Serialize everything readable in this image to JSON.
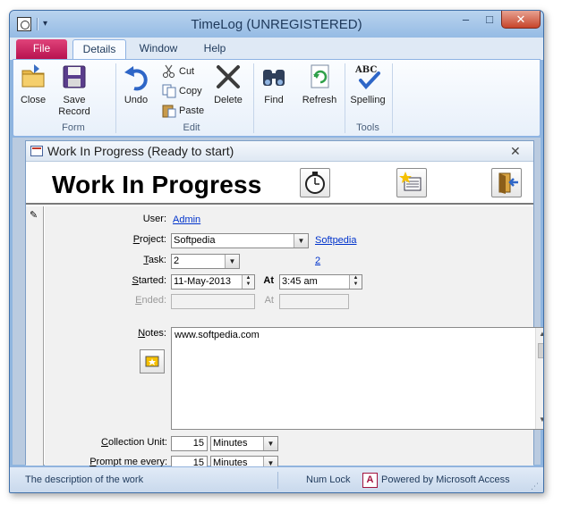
{
  "window": {
    "title": "TimeLog (UNREGISTERED)",
    "qat_dropdown": "▾",
    "min": "–",
    "max": "□",
    "close": "✕"
  },
  "ribbon": {
    "tabs": [
      {
        "label": "File"
      },
      {
        "label": "Details"
      },
      {
        "label": "Window"
      },
      {
        "label": "Help"
      }
    ],
    "groups": {
      "form": "Form",
      "edit": "Edit",
      "tools": "Tools"
    },
    "buttons": {
      "close": "Close",
      "save": "Save",
      "save_line2": "Record",
      "undo": "Undo",
      "cut": "Cut",
      "copy": "Copy",
      "paste": "Paste",
      "delete": "Delete",
      "find": "Find",
      "refresh": "Refresh",
      "spelling": "Spelling"
    }
  },
  "form": {
    "title": "Work In Progress (Ready to start)",
    "close": "✕",
    "heading": "Work In Progress",
    "record_selector_icon": "✎",
    "fields": {
      "user_label": "User:",
      "user_value": "Admin",
      "project_label_u": "P",
      "project_label_rest": "roject:",
      "project_value": "Softpedia",
      "project_link": "Softpedia",
      "task_label_u": "T",
      "task_label_rest": "ask:",
      "task_value": "2",
      "task_link": "2",
      "started_label_u": "S",
      "started_label_rest": "tarted:",
      "started_date": "11-May-2013",
      "at_label": "At",
      "started_time": "3:45 am",
      "ended_label_u": "E",
      "ended_label_rest": "nded:",
      "ended_at_label": "At",
      "notes_label_u": "N",
      "notes_label_rest": "otes:",
      "notes_value": "www.softpedia.com",
      "collection_label_u": "C",
      "collection_label_rest": "ollection Unit:",
      "collection_value": "15",
      "collection_unit": "Minutes",
      "prompt_label_u": "P",
      "prompt_label_rest": "rompt me every:",
      "prompt_value": "15",
      "prompt_unit": "Minutes"
    }
  },
  "status": {
    "text": "The description of the work",
    "numlock": "Num Lock",
    "logo": "A",
    "powered": "Powered by Microsoft Access"
  },
  "icons": [
    "app-icon",
    "close-form-icon",
    "save-icon",
    "undo-icon",
    "cut-icon",
    "copy-icon",
    "paste-icon",
    "delete-icon",
    "find-icon",
    "refresh-icon",
    "spelling-icon",
    "stopwatch-icon",
    "new-task-icon",
    "exit-icon",
    "pencil-icon",
    "notes-stamp-icon",
    "access-logo-icon"
  ],
  "colors": {
    "file_tab": "#c8185a",
    "title_bar": "#aac8eb",
    "link": "#0033cc",
    "close_button": "#c7452b"
  }
}
